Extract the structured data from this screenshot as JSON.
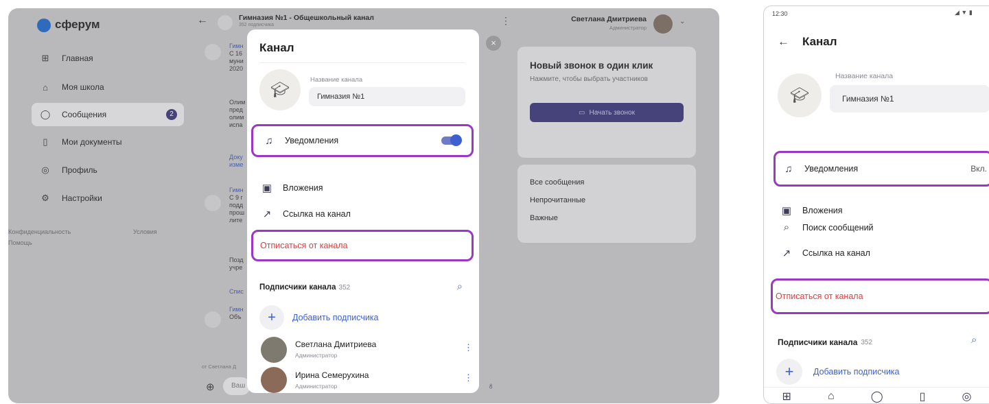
{
  "desktop": {
    "logo": "сферум",
    "nav": [
      {
        "label": "Главная",
        "icon": "grid-icon"
      },
      {
        "label": "Моя школа",
        "icon": "school-icon"
      },
      {
        "label": "Сообщения",
        "icon": "message-icon",
        "badge": "2"
      },
      {
        "label": "Мои документы",
        "icon": "document-icon"
      },
      {
        "label": "Профиль",
        "icon": "profile-icon"
      },
      {
        "label": "Настройки",
        "icon": "settings-icon"
      }
    ],
    "footer_links": [
      "Конфиденциальность",
      "Условия",
      "Помощь"
    ],
    "channel_title": "Гимназия №1 - Общешкольный канал",
    "channel_subtitle": "352 подписчика",
    "user_name": "Светлана Дмитриева",
    "user_role": "Администратор",
    "chat_snippets": [
      "Гимн",
      "С 16",
      "муни",
      "2020",
      "Олим",
      "пред",
      "олим",
      "испа",
      "Доку",
      "изме",
      "Гимн",
      "С 9 г",
      "подд",
      "прош",
      "лите",
      "Позд",
      "учре",
      "Спис",
      "Гимн",
      "Объ"
    ],
    "composer_sender": "от Светлана Д",
    "composer_placeholder": "Ваш",
    "call_card": {
      "title": "Новый звонок в один клик",
      "subtitle": "Нажмите, чтобы выбрать участников",
      "button": "Начать звонок"
    },
    "filters": [
      "Все сообщения",
      "Непрочитанные",
      "Важные"
    ]
  },
  "modal": {
    "title": "Канал",
    "name_label": "Название канала",
    "name_value": "Гимназия №1",
    "notifications": "Уведомления",
    "attachments": "Вложения",
    "link": "Ссылка на канал",
    "unsubscribe": "Отписаться от канала",
    "subscribers_label": "Подписчики канала",
    "subscribers_count": "352",
    "add_subscriber": "Добавить подписчика",
    "members": [
      {
        "name": "Светлана Дмитриева",
        "role": "Администратор"
      },
      {
        "name": "Ирина Семерухина",
        "role": "Администратор"
      }
    ]
  },
  "phone": {
    "time": "12:30",
    "title": "Канал",
    "name_label": "Название канала",
    "name_value": "Гимназия №1",
    "notifications": "Уведомления",
    "notifications_state": "Вкл.",
    "attachments": "Вложения",
    "search": "Поиск сообщений",
    "link": "Ссылка на канал",
    "unsubscribe": "Отписаться от канала",
    "subscribers_label": "Подписчики канала",
    "subscribers_count": "352",
    "add_subscriber": "Добавить подписчика",
    "tab_icons": [
      "grid-icon",
      "school-icon",
      "message-icon",
      "document-icon",
      "profile-icon"
    ]
  },
  "colors": {
    "accent": "#3d5fd0",
    "danger": "#e23c3c",
    "highlight": "#9a37c6",
    "call_button": "#45437a"
  }
}
